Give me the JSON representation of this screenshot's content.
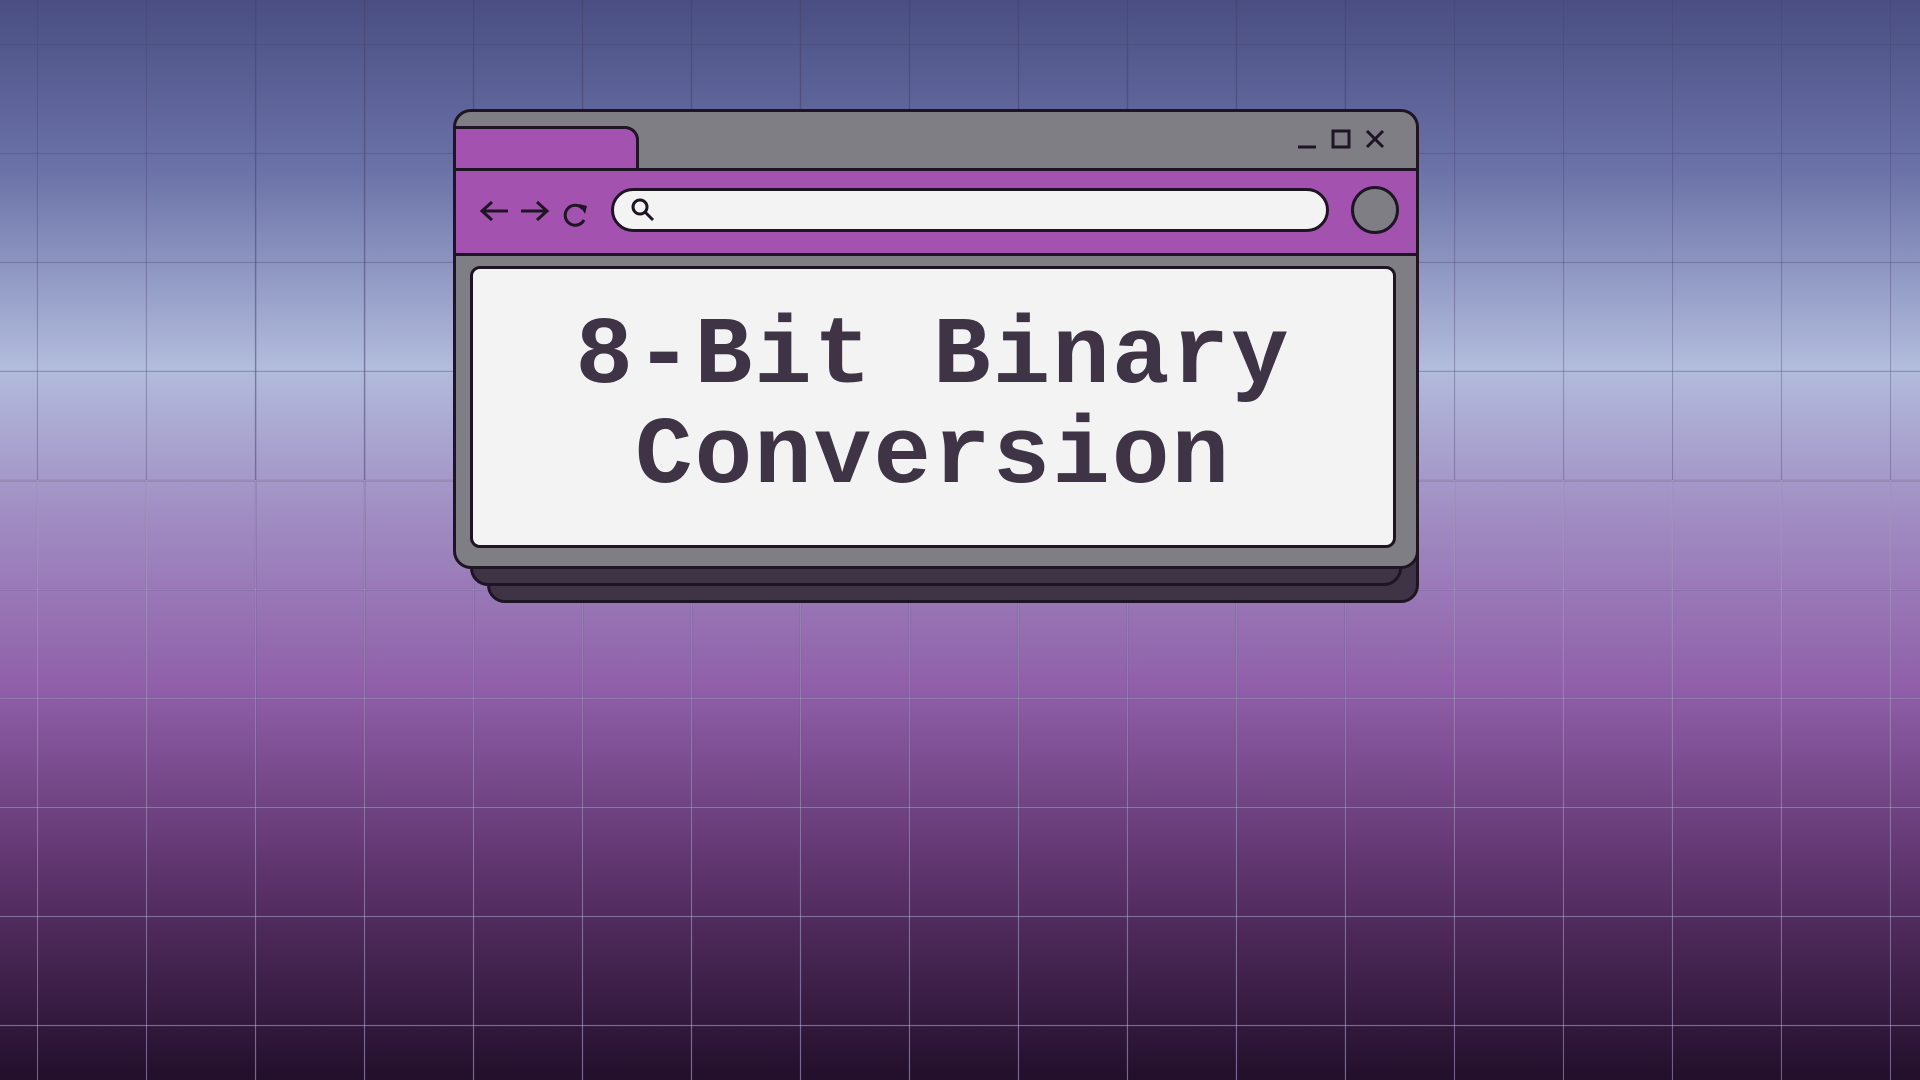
{
  "colors": {
    "accent": "#a452b0",
    "frame": "#7f7e84",
    "outline": "#1e1424",
    "shadow_window": "#3e3446",
    "content_bg": "#f3f3f3",
    "text": "#3e3446"
  },
  "window": {
    "controls": [
      {
        "name": "minimize",
        "icon": "minimize-icon"
      },
      {
        "name": "maximize",
        "icon": "maximize-icon"
      },
      {
        "name": "close",
        "icon": "close-icon"
      }
    ]
  },
  "toolbar": {
    "nav_icons": [
      "arrow-left-icon",
      "arrow-right-icon",
      "reload-icon"
    ],
    "address_bar": {
      "value": "",
      "placeholder": "",
      "icon": "search-icon"
    }
  },
  "content": {
    "title_line_1": "8-Bit Binary",
    "title_line_2": "Conversion"
  }
}
